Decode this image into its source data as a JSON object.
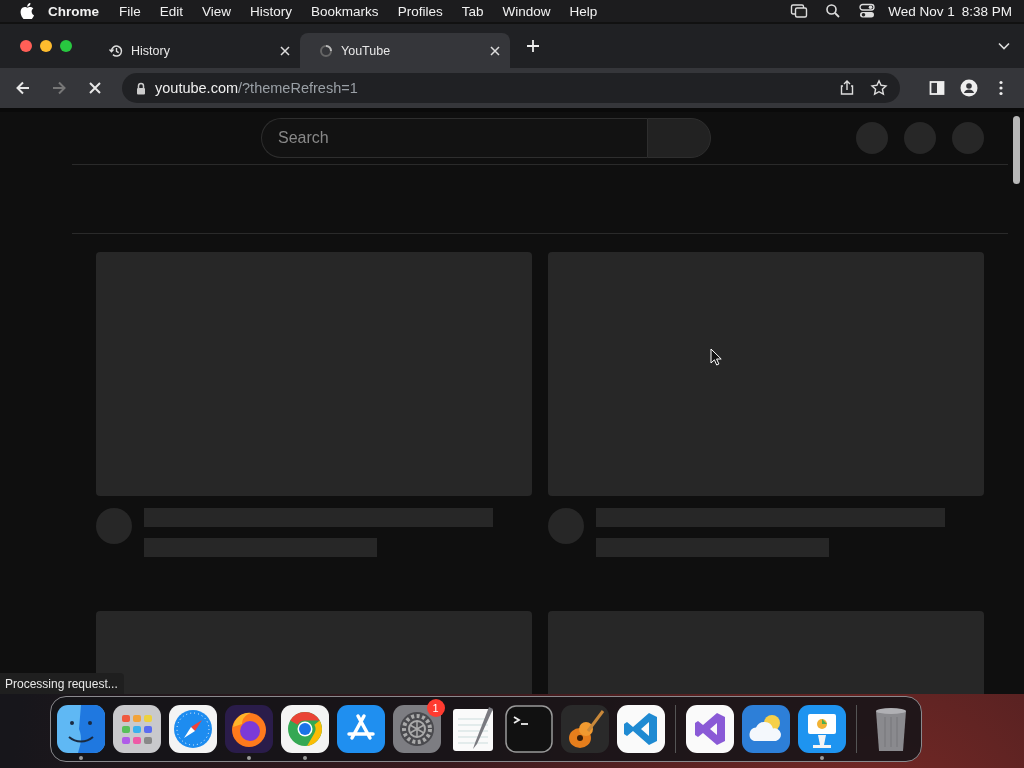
{
  "menu_bar": {
    "app": "Chrome",
    "items": [
      "File",
      "Edit",
      "View",
      "History",
      "Bookmarks",
      "Profiles",
      "Tab",
      "Window",
      "Help"
    ],
    "status_icons": [
      {
        "kind": "screen-mirroring"
      },
      {
        "kind": "search"
      },
      {
        "kind": "control-center"
      }
    ],
    "date": "Wed Nov 1",
    "time": "8:38 PM"
  },
  "tabs": [
    {
      "title": "History",
      "kind": "history",
      "selected": false
    },
    {
      "title": "YouTube",
      "kind": "loading",
      "selected": true
    }
  ],
  "nav_buttons": [
    {
      "kind": "back",
      "disabled": false
    },
    {
      "kind": "forward",
      "disabled": true
    },
    {
      "kind": "stop",
      "disabled": false
    }
  ],
  "address": {
    "host": "youtube.com",
    "path": "/?themeRefresh=1"
  },
  "toolbar_icons": [
    {
      "kind": "share"
    },
    {
      "kind": "star"
    },
    {
      "kind": "side-panel"
    },
    {
      "kind": "profile"
    },
    {
      "kind": "menu"
    }
  ],
  "page": {
    "search": {
      "placeholder": "Search"
    },
    "skeleton_cards": [
      {
        "kind": "with-details"
      },
      {
        "kind": "with-details"
      },
      {
        "kind": "thumbnail-only"
      },
      {
        "kind": "thumbnail-only"
      }
    ]
  },
  "status_bar": "Processing request...",
  "dock": [
    {
      "kind": "finder",
      "running": true
    },
    {
      "kind": "launchpad",
      "running": false
    },
    {
      "kind": "safari",
      "running": false
    },
    {
      "kind": "firefox",
      "running": true
    },
    {
      "kind": "chrome",
      "running": true
    },
    {
      "kind": "app-store",
      "running": false
    },
    {
      "kind": "settings",
      "running": false,
      "badge": "1"
    },
    {
      "kind": "textedit",
      "running": false
    },
    {
      "kind": "terminal",
      "running": false
    },
    {
      "kind": "garageband",
      "running": false
    },
    {
      "kind": "vscode",
      "running": false
    },
    {
      "kind": "separator"
    },
    {
      "kind": "visual-studio",
      "running": false
    },
    {
      "kind": "weather",
      "running": false
    },
    {
      "kind": "keynote",
      "running": true
    },
    {
      "kind": "separator"
    },
    {
      "kind": "trash",
      "running": false
    }
  ]
}
